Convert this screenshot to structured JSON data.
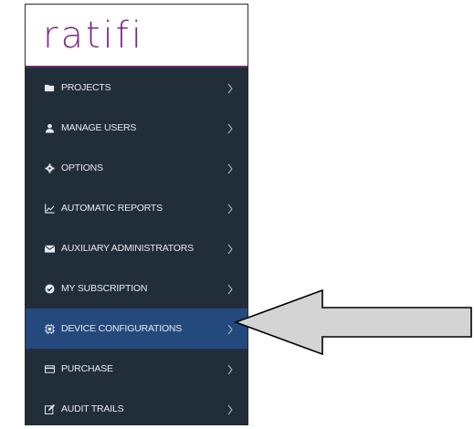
{
  "app": {
    "logo_text": "ratifi"
  },
  "sidebar": {
    "items": [
      {
        "label": "PROJECTS",
        "icon": "folder-icon"
      },
      {
        "label": "MANAGE USERS",
        "icon": "user-icon"
      },
      {
        "label": "OPTIONS",
        "icon": "gear-icon"
      },
      {
        "label": "AUTOMATIC REPORTS",
        "icon": "line-chart-icon"
      },
      {
        "label": "AUXILIARY ADMINISTRATORS",
        "icon": "envelope-icon"
      },
      {
        "label": "MY SUBSCRIPTION",
        "icon": "check-circle-icon"
      },
      {
        "label": "DEVICE CONFIGURATIONS",
        "icon": "device-icon",
        "active": true
      },
      {
        "label": "PURCHASE",
        "icon": "credit-card-icon"
      },
      {
        "label": "AUDIT TRAILS",
        "icon": "edit-icon"
      }
    ]
  },
  "annotation": {
    "icon": "pointer-arrow-icon",
    "fill": "#d4d4d4",
    "stroke": "#000000"
  },
  "colors": {
    "sidebar_bg": "#222d3a",
    "active_bg": "#24497c",
    "logo": "#7b2a88"
  }
}
